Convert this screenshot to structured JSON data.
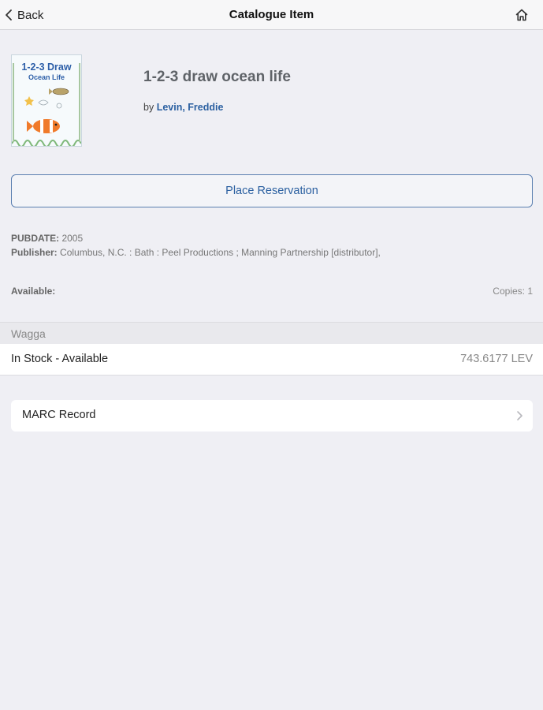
{
  "nav": {
    "back_label": "Back",
    "title": "Catalogue Item"
  },
  "item": {
    "title": "1-2-3 draw ocean life",
    "by_prefix": "by",
    "author": "Levin, Freddie",
    "cover": {
      "line1": "1-2-3 Draw",
      "line2": "Ocean Life"
    }
  },
  "reserve_label": "Place Reservation",
  "meta": {
    "pubdate_label": "PUBDATE:",
    "pubdate_value": "2005",
    "publisher_label": "Publisher:",
    "publisher_value": "Columbus, N.C. : Bath : Peel Productions ; Manning Partnership [distributor],"
  },
  "availability": {
    "label": "Available:",
    "copies": "Copies: 1"
  },
  "holdings": {
    "branch": "Wagga",
    "status": "In Stock - Available",
    "call_number": "743.6177 LEV"
  },
  "marc_label": "MARC Record",
  "colors": {
    "accent": "#2a5fa0",
    "background": "#efeff4"
  }
}
